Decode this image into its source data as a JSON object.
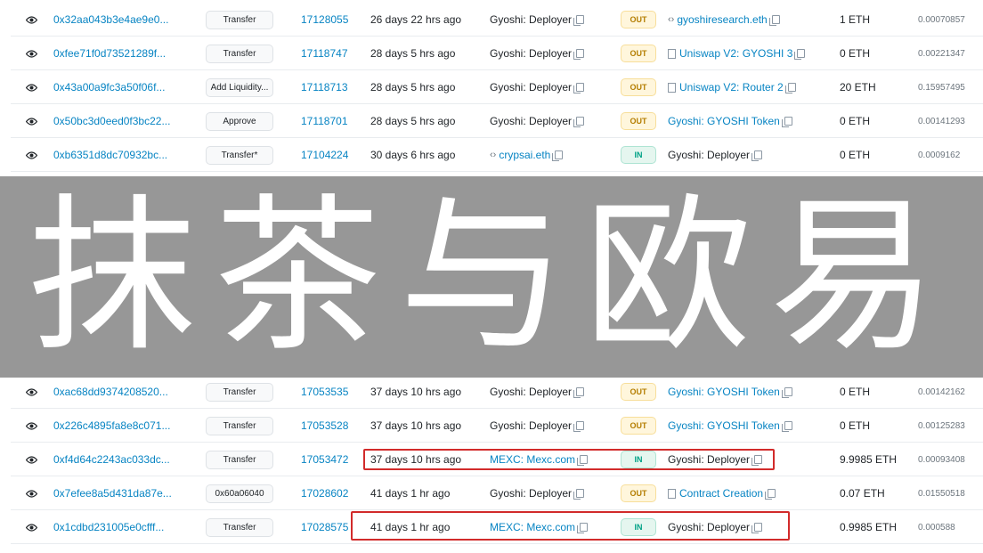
{
  "banner": {
    "text": "抹茶与欧易"
  },
  "transactions_top": [
    {
      "hash": "0x32aa043b3e4ae9e0...",
      "method": "Transfer",
      "block": "17128055",
      "age": "26 days 22 hrs ago",
      "from": "Gyoshi: Deployer",
      "direction": "OUT",
      "to": "gyoshiresearch.eth",
      "to_icon": "code",
      "value": "1 ETH",
      "fee": "0.00070857"
    },
    {
      "hash": "0xfee71f0d73521289f...",
      "method": "Transfer",
      "block": "17118747",
      "age": "28 days 5 hrs ago",
      "from": "Gyoshi: Deployer",
      "direction": "OUT",
      "to": "Uniswap V2: GYOSHI 3",
      "to_icon": "doc",
      "value": "0 ETH",
      "fee": "0.00221347"
    },
    {
      "hash": "0x43a00a9fc3a50f06f...",
      "method": "Add Liquidity...",
      "block": "17118713",
      "age": "28 days 5 hrs ago",
      "from": "Gyoshi: Deployer",
      "direction": "OUT",
      "to": "Uniswap V2: Router 2",
      "to_icon": "doc",
      "value": "20 ETH",
      "fee": "0.15957495"
    },
    {
      "hash": "0x50bc3d0eed0f3bc22...",
      "method": "Approve",
      "block": "17118701",
      "age": "28 days 5 hrs ago",
      "from": "Gyoshi: Deployer",
      "direction": "OUT",
      "to": "Gyoshi: GYOSHI Token",
      "to_icon": "",
      "value": "0 ETH",
      "fee": "0.00141293"
    },
    {
      "hash": "0xb6351d8dc70932bc...",
      "method": "Transfer*",
      "block": "17104224",
      "age": "30 days 6 hrs ago",
      "from": "crypsai.eth",
      "from_icon": "code",
      "direction": "IN",
      "to": "Gyoshi: Deployer",
      "to_icon": "",
      "value": "0 ETH",
      "fee": "0.0009162"
    }
  ],
  "transactions_bottom": [
    {
      "hash": "0xac68dd9374208520...",
      "method": "Transfer",
      "block": "17053535",
      "age": "37 days 10 hrs ago",
      "from": "Gyoshi: Deployer",
      "direction": "OUT",
      "to": "Gyoshi: GYOSHI Token",
      "to_icon": "",
      "value": "0 ETH",
      "fee": "0.00142162"
    },
    {
      "hash": "0x226c4895fa8e8c071...",
      "method": "Transfer",
      "block": "17053528",
      "age": "37 days 10 hrs ago",
      "from": "Gyoshi: Deployer",
      "direction": "OUT",
      "to": "Gyoshi: GYOSHI Token",
      "to_icon": "",
      "value": "0 ETH",
      "fee": "0.00125283"
    },
    {
      "hash": "0xf4d64c2243ac033dc...",
      "method": "Transfer",
      "block": "17053472",
      "age": "37 days 10 hrs ago",
      "from": "MEXC: Mexc.com",
      "direction": "IN",
      "to": "Gyoshi: Deployer",
      "to_icon": "",
      "value": "9.9985 ETH",
      "fee": "0.00093408"
    },
    {
      "hash": "0x7efee8a5d431da87e...",
      "method": "0x60a06040",
      "block": "17028602",
      "age": "41 days 1 hr ago",
      "from": "Gyoshi: Deployer",
      "direction": "OUT",
      "to": "Contract Creation",
      "to_icon": "doc",
      "value": "0.07 ETH",
      "fee": "0.01550518"
    },
    {
      "hash": "0x1cdbd231005e0cfff...",
      "method": "Transfer",
      "block": "17028575",
      "age": "41 days 1 hr ago",
      "from": "MEXC: Mexc.com",
      "direction": "IN",
      "to": "Gyoshi: Deployer",
      "to_icon": "",
      "value": "0.9985 ETH",
      "fee": "0.000588"
    }
  ],
  "colors": {
    "highlight": "#d22b2b",
    "link": "#0784c3",
    "banner_bg": "#979797"
  },
  "icons": {
    "view": "eye-icon",
    "copy": "copy-icon",
    "contract": "code-icon",
    "document": "document-icon"
  }
}
